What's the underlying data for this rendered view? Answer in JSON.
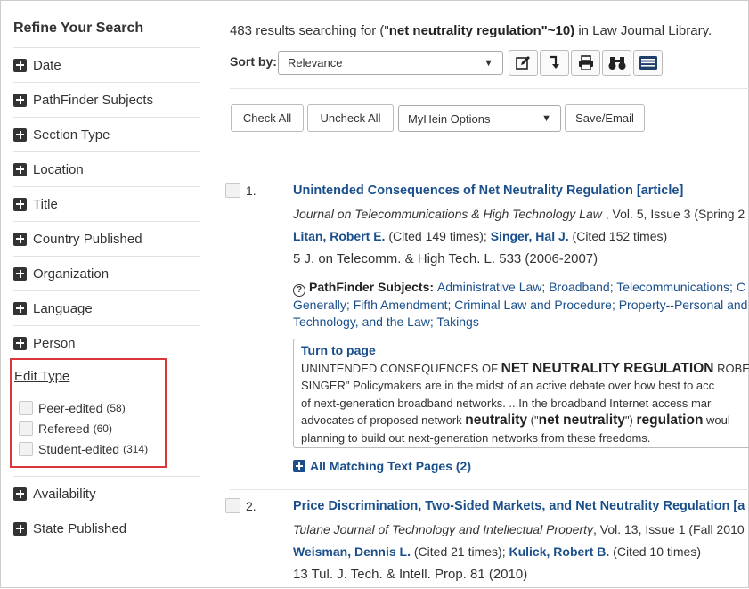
{
  "sidebar": {
    "title": "Refine Your Search",
    "facets_top": [
      "Date",
      "PathFinder Subjects",
      "Section Type",
      "Location",
      "Title",
      "Country Published",
      "Organization",
      "Language",
      "Person"
    ],
    "edit_type": {
      "label": "Edit Type",
      "options": [
        {
          "label": "Peer-edited",
          "count": "(58)"
        },
        {
          "label": "Refereed",
          "count": "(60)"
        },
        {
          "label": "Student-edited",
          "count": "(314)"
        }
      ]
    },
    "facets_bottom": [
      "Availability",
      "State Published"
    ]
  },
  "summary": {
    "prefix": "483 results searching for (\"",
    "query": "net neutrality regulation",
    "middle": "\"~10)",
    "suffix": " in Law Journal Library."
  },
  "sort": {
    "label": "Sort by:",
    "selected": "Relevance"
  },
  "toolbar_icons": [
    "edit-icon",
    "download-icon",
    "print-icon",
    "binoculars-icon",
    "list-view-icon"
  ],
  "actions": {
    "check_all": "Check All",
    "uncheck_all": "Uncheck All",
    "myhein": "MyHein Options",
    "save_email": "Save/Email"
  },
  "results": [
    {
      "num": "1.",
      "title": "Unintended Consequences of Net Neutrality Regulation [article]",
      "journal": "Journal on Telecommunications & High Technology Law",
      "journal_meta": " , Vol. 5, Issue 3 (Spring 2",
      "author1": "Litan, Robert E.",
      "cite1": " (Cited 149 times); ",
      "author2": "Singer, Hal J.",
      "cite2": " (Cited 152 times)",
      "citation": "5 J. on Telecomm. & High Tech. L. 533 (2006-2007)",
      "pathfinder_label": "PathFinder Subjects: ",
      "pathfinder_text": "Administrative Law; Broadband; Telecommunications; C",
      "pathfinder_line2": "Generally; Fifth Amendment; Criminal Law and Procedure; Property--Personal and",
      "pathfinder_line3": "Technology, and the Law; Takings",
      "snippet": {
        "turn_to_page": "Turn to page",
        "l1a": "UNINTENDED CONSEQUENCES OF ",
        "l1b": "NET NEUTRALITY REGULATION",
        "l1c": " ROBER",
        "l2": "SINGER\" Policymakers are in the midst of an active debate over how best to acc",
        "l3": "of next-generation broadband networks. ...In the broadband Internet access mar",
        "l4a": "advocates of proposed network ",
        "l4b": "neutrality",
        "l4c": " (\"",
        "l4d": "net neutrality",
        "l4e": "\") ",
        "l4f": "regulation",
        "l4g": " woul",
        "l5": "planning to build out next-generation networks from these freedoms."
      },
      "all_matching": "All Matching Text Pages (2)"
    },
    {
      "num": "2.",
      "title": "Price Discrimination, Two-Sided Markets, and Net Neutrality Regulation [a",
      "journal": "Tulane Journal of Technology and Intellectual Property",
      "journal_meta": ", Vol. 13, Issue 1 (Fall 2010",
      "author1": "Weisman, Dennis L.",
      "cite1": " (Cited 21 times); ",
      "author2": "Kulick, Robert B.",
      "cite2": " (Cited 10 times)",
      "citation": "13 Tul. J. Tech. & Intell. Prop. 81 (2010)"
    }
  ]
}
